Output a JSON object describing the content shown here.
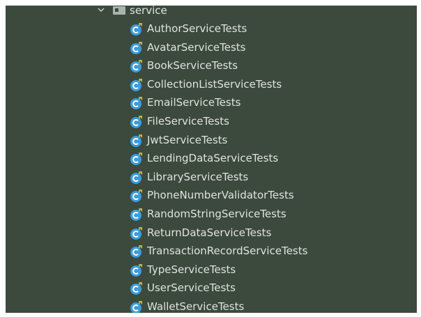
{
  "project_tree": {
    "folder": {
      "name": "service",
      "expanded": true,
      "icon": "folder-icon"
    },
    "files": [
      {
        "label": "AuthorServiceTests",
        "icon": "test-class-icon"
      },
      {
        "label": "AvatarServiceTests",
        "icon": "test-class-icon"
      },
      {
        "label": "BookServiceTests",
        "icon": "test-class-icon"
      },
      {
        "label": "CollectionListServiceTests",
        "icon": "test-class-icon"
      },
      {
        "label": "EmailServiceTests",
        "icon": "test-class-icon"
      },
      {
        "label": "FileServiceTests",
        "icon": "test-class-icon"
      },
      {
        "label": "JwtServiceTests",
        "icon": "test-class-icon"
      },
      {
        "label": "LendingDataServiceTests",
        "icon": "test-class-icon"
      },
      {
        "label": "LibraryServiceTests",
        "icon": "test-class-icon"
      },
      {
        "label": "PhoneNumberValidatorTests",
        "icon": "test-class-icon"
      },
      {
        "label": "RandomStringServiceTests",
        "icon": "test-class-icon"
      },
      {
        "label": "ReturnDataServiceTests",
        "icon": "test-class-icon"
      },
      {
        "label": "TransactionRecordServiceTests",
        "icon": "test-class-icon"
      },
      {
        "label": "TypeServiceTests",
        "icon": "test-class-icon"
      },
      {
        "label": "UserServiceTests",
        "icon": "test-class-icon"
      },
      {
        "label": "WalletServiceTests",
        "icon": "test-class-icon"
      }
    ]
  },
  "colors": {
    "panel_background": "#3c4a3e",
    "text": "#dfe3de",
    "class_icon": "#3a9ddc",
    "test_marker": "#e8a33c",
    "folder_icon": "#aab4ab"
  }
}
